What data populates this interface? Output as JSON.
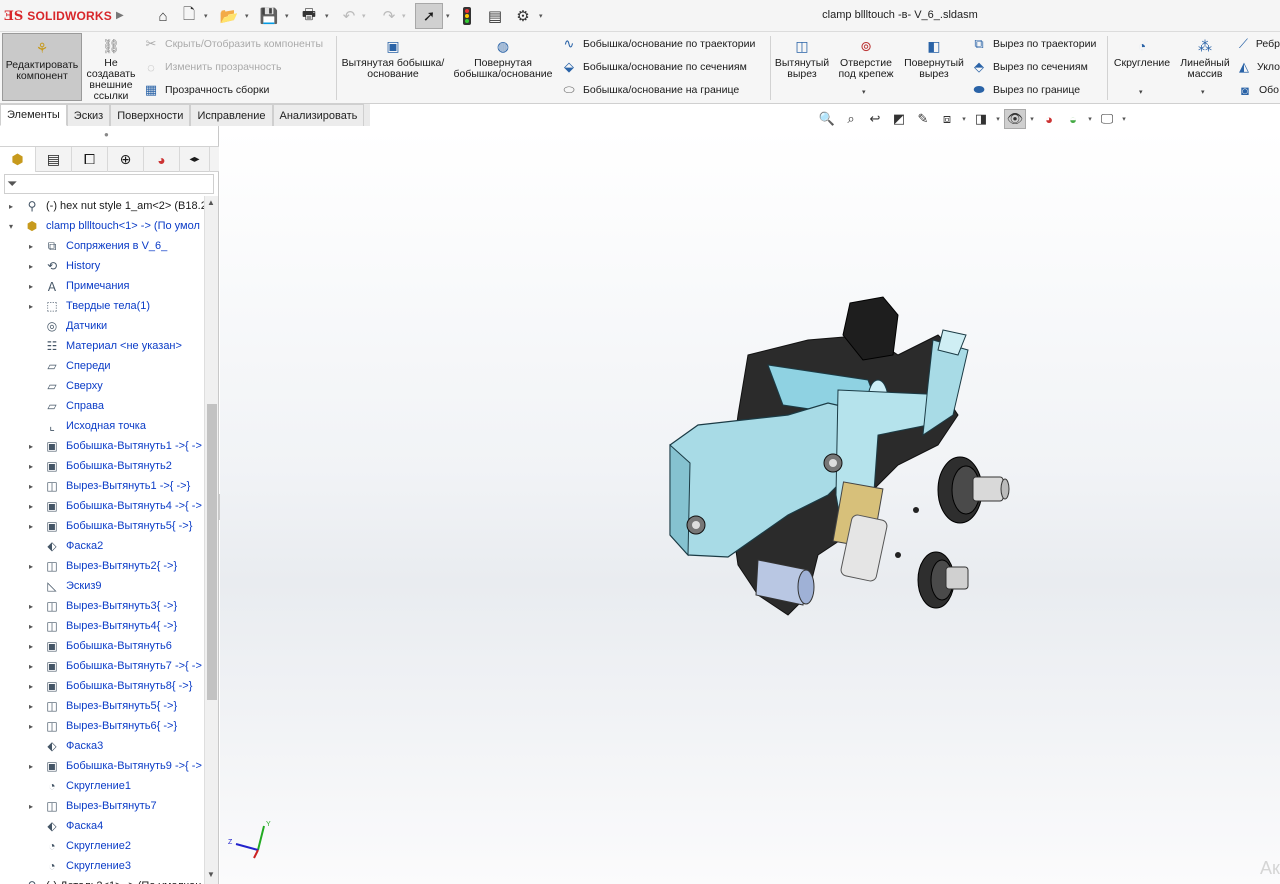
{
  "app": {
    "brand": "SOLIDWORKS",
    "document_title": "clamp bllltouch -в- V_6_.sldasm",
    "watermark": "Ак"
  },
  "ribbon": {
    "edit_component": "Редактировать компонент",
    "no_external_refs": "Не создавать внешние ссылки",
    "hide_show": "Скрыть/Отобразить компоненты",
    "change_transparency": "Изменить прозрачность",
    "assembly_transparency": "Прозрачность сборки",
    "extruded_boss": "Вытянутая бобышка/основание",
    "revolved_boss": "Повернутая бобышка/основание",
    "swept_boss": "Бобышка/основание по траектории",
    "lofted_boss": "Бобышка/основание по сечениям",
    "boundary_boss": "Бобышка/основание на границе",
    "extruded_cut": "Вытянутый вырез",
    "hole_wizard": "Отверстие под крепеж",
    "revolved_cut": "Повернутый вырез",
    "swept_cut": "Вырез по траектории",
    "lofted_cut": "Вырез по сечениям",
    "boundary_cut": "Вырез по границе",
    "fillet": "Скругление",
    "linear_pattern": "Линейный массив",
    "rib": "Ребр",
    "draft": "Укло",
    "shell": "Обо"
  },
  "tabs": [
    "Элементы",
    "Эскиз",
    "Поверхности",
    "Исправление",
    "Анализировать"
  ],
  "tree": [
    {
      "label": "(-) hex nut style 1_am<2> (B18.2.",
      "icon": "part-icon",
      "expand": "▸",
      "level": 0,
      "dark": true
    },
    {
      "label": "clamp bllltouch<1> -> (По умол",
      "icon": "assembly-icon",
      "expand": "▾",
      "level": 0
    },
    {
      "label": "Сопряжения в V_6_",
      "icon": "mates-icon",
      "expand": "▸",
      "level": 1
    },
    {
      "label": "History",
      "icon": "history-icon",
      "expand": "▸",
      "level": 1
    },
    {
      "label": "Примечания",
      "icon": "annotations-icon",
      "expand": "▸",
      "level": 1
    },
    {
      "label": "Твердые тела(1)",
      "icon": "solid-bodies-icon",
      "expand": "▸",
      "level": 1
    },
    {
      "label": "Датчики",
      "icon": "sensors-icon",
      "expand": "",
      "level": 1
    },
    {
      "label": "Материал <не указан>",
      "icon": "material-icon",
      "expand": "",
      "level": 1
    },
    {
      "label": "Спереди",
      "icon": "plane-icon",
      "expand": "",
      "level": 1
    },
    {
      "label": "Сверху",
      "icon": "plane-icon",
      "expand": "",
      "level": 1
    },
    {
      "label": "Справа",
      "icon": "plane-icon",
      "expand": "",
      "level": 1
    },
    {
      "label": "Исходная точка",
      "icon": "origin-icon",
      "expand": "",
      "level": 1
    },
    {
      "label": "Бобышка-Вытянуть1 ->{ ->",
      "icon": "extrude-icon",
      "expand": "▸",
      "level": 1
    },
    {
      "label": "Бобышка-Вытянуть2",
      "icon": "extrude-icon",
      "expand": "▸",
      "level": 1
    },
    {
      "label": "Вырез-Вытянуть1 ->{ ->}",
      "icon": "cut-icon",
      "expand": "▸",
      "level": 1
    },
    {
      "label": "Бобышка-Вытянуть4 ->{ ->",
      "icon": "extrude-icon",
      "expand": "▸",
      "level": 1
    },
    {
      "label": "Бобышка-Вытянуть5{ ->}",
      "icon": "extrude-icon",
      "expand": "▸",
      "level": 1
    },
    {
      "label": "Фаска2",
      "icon": "chamfer-icon",
      "expand": "",
      "level": 1
    },
    {
      "label": "Вырез-Вытянуть2{ ->}",
      "icon": "cut-icon",
      "expand": "▸",
      "level": 1
    },
    {
      "label": "Эскиз9",
      "icon": "sketch-icon",
      "expand": "",
      "level": 1
    },
    {
      "label": "Вырез-Вытянуть3{ ->}",
      "icon": "cut-icon",
      "expand": "▸",
      "level": 1
    },
    {
      "label": "Вырез-Вытянуть4{ ->}",
      "icon": "cut-icon",
      "expand": "▸",
      "level": 1
    },
    {
      "label": "Бобышка-Вытянуть6",
      "icon": "extrude-icon",
      "expand": "▸",
      "level": 1
    },
    {
      "label": "Бобышка-Вытянуть7 ->{ ->",
      "icon": "extrude-icon",
      "expand": "▸",
      "level": 1
    },
    {
      "label": "Бобышка-Вытянуть8{ ->}",
      "icon": "extrude-icon",
      "expand": "▸",
      "level": 1
    },
    {
      "label": "Вырез-Вытянуть5{ ->}",
      "icon": "cut-icon",
      "expand": "▸",
      "level": 1
    },
    {
      "label": "Вырез-Вытянуть6{ ->}",
      "icon": "cut-icon",
      "expand": "▸",
      "level": 1
    },
    {
      "label": "Фаска3",
      "icon": "chamfer-icon",
      "expand": "",
      "level": 1
    },
    {
      "label": "Бобышка-Вытянуть9 ->{ ->",
      "icon": "extrude-icon",
      "expand": "▸",
      "level": 1
    },
    {
      "label": "Скругление1",
      "icon": "fillet-icon",
      "expand": "",
      "level": 1
    },
    {
      "label": "Вырез-Вытянуть7",
      "icon": "cut-icon",
      "expand": "▸",
      "level": 1
    },
    {
      "label": "Фаска4",
      "icon": "chamfer-icon",
      "expand": "",
      "level": 1
    },
    {
      "label": "Скругление2",
      "icon": "fillet-icon",
      "expand": "",
      "level": 1
    },
    {
      "label": "Скругление3",
      "icon": "fillet-icon",
      "expand": "",
      "level": 1
    },
    {
      "label": "(-) Деталь2<1> -> (По умолчан",
      "icon": "part-icon",
      "expand": "▸",
      "level": 0,
      "dark": true
    }
  ],
  "colors": {
    "tree_text": "#0b3cc7",
    "accent": "#d8262a",
    "model_blue": "#a8dbe6"
  }
}
